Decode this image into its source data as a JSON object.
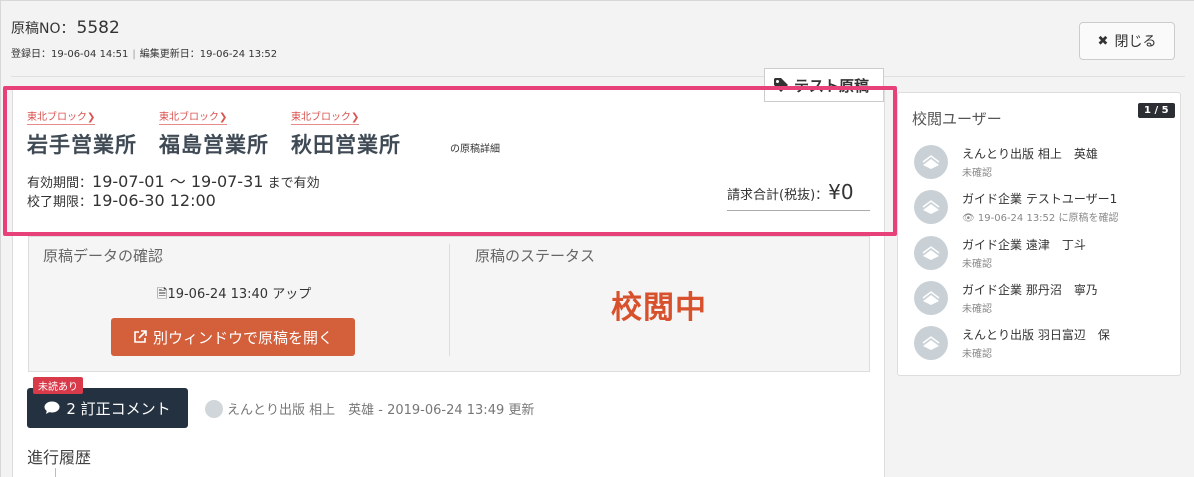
{
  "header": {
    "no_label": "原稿NO：",
    "no_value": "5582",
    "registered": "登録日：19-06-04 14:51",
    "date_sep": "|",
    "updated": "編集更新日：19-06-24 13:52",
    "close_icon": "x-icon",
    "close_label": "閉じる"
  },
  "tag": {
    "icon": "tag-icon",
    "label": "テスト原稿"
  },
  "offices": [
    {
      "region": "東北ブロック",
      "name": "岩手営業所"
    },
    {
      "region": "東北ブロック",
      "name": "福島営業所"
    },
    {
      "region": "東北ブロック",
      "name": "秋田営業所"
    }
  ],
  "detail_suffix": "の原稿詳細",
  "validity": {
    "label": "有効期間：",
    "value": "19-07-01 〜 19-07-31",
    "suffix": "まで有効"
  },
  "deadline": {
    "label": "校了期限：",
    "value": "19-06-30 12:00"
  },
  "billing": {
    "label": "請求合計(税抜)：",
    "amount": "¥0"
  },
  "data_check": {
    "title": "原稿データの確認",
    "upload_icon": "file-icon",
    "upload_text": "19-06-24 13:40 アップ",
    "open_icon": "external-link-icon",
    "open_label": "別ウィンドウで原稿を開く"
  },
  "status": {
    "title": "原稿のステータス",
    "value": "校閲中"
  },
  "comments": {
    "badge": "未読あり",
    "icon": "comment-icon",
    "label": "2 訂正コメント",
    "meta": "えんとり出版 相上　英雄 - 2019-06-24 13:49 更新"
  },
  "history_title": "進行履歴",
  "reviewers": {
    "title": "校閲ユーザー",
    "count": "1 / 5",
    "users": [
      {
        "name": "えんとり出版 相上　英雄",
        "status": "未確認"
      },
      {
        "name": "ガイド企業 テストユーザー1",
        "status": "19-06-24 13:52 に原稿を確認",
        "icon": "eye-icon"
      },
      {
        "name": "ガイド企業 遠津　丁斗",
        "status": "未確認"
      },
      {
        "name": "ガイド企業 那丹沼　寧乃",
        "status": "未確認"
      },
      {
        "name": "えんとり出版 羽日富辺　保",
        "status": "未確認"
      }
    ]
  },
  "colors": {
    "highlight": "#e8417a",
    "region": "#d9534f",
    "status": "#d8512d",
    "open_button": "#d35f3b",
    "comment_button": "#243140",
    "unread": "#d93a4a"
  }
}
